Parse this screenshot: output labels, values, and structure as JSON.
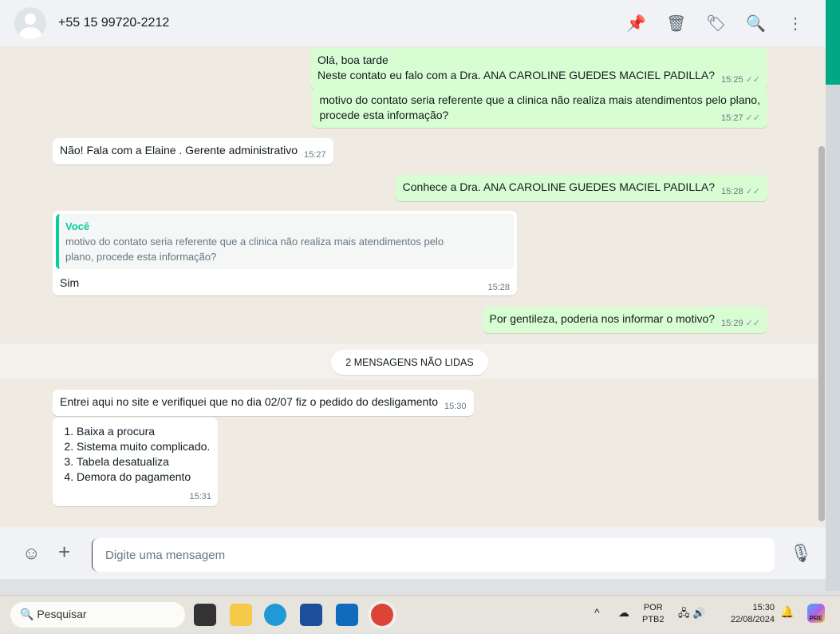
{
  "header": {
    "contact": "+55 15 99720-2212",
    "icons": [
      "pin-icon",
      "delete-icon",
      "label-icon",
      "search-icon",
      "menu-icon"
    ]
  },
  "messages": [
    {
      "dir": "out",
      "lines": [
        "Olá, boa tarde",
        "Neste contato eu falo com a Dra. ANA CAROLINE GUEDES MACIEL PADILLA?"
      ],
      "time": "15:25"
    },
    {
      "dir": "out",
      "lines": [
        "motivo do contato seria referente que a clinica não realiza mais atendimentos pelo plano,",
        "procede esta informação?"
      ],
      "time": "15:27"
    },
    {
      "dir": "in",
      "text": "Não! Fala com a Elaine . Gerente administrativo",
      "time": "15:27"
    },
    {
      "dir": "out",
      "text": "Conhece a Dra. ANA CAROLINE GUEDES MACIEL PADILLA?",
      "time": "15:28"
    },
    {
      "dir": "in",
      "quote_author": "Você",
      "quote_lines": [
        "motivo do contato seria referente que a clinica não realiza mais atendimentos pelo",
        "plano, procede esta informação?"
      ],
      "text": "Sim",
      "time": "15:28"
    },
    {
      "dir": "out",
      "text": "Por gentileza, poderia nos informar o motivo?",
      "time": "15:29"
    },
    {
      "dir": "in",
      "text": "Entrei aqui no site e verifiquei que no dia 02/07 fiz o pedido do desligamento",
      "time": "15:30"
    },
    {
      "dir": "in",
      "list": [
        "Baixa a procura",
        "Sistema muito complicado.",
        "Tabela desatualiza",
        "Demora do pagamento"
      ],
      "time": "15:31"
    }
  ],
  "unread_label": "2 MENSAGENS NÃO LIDAS",
  "composer": {
    "placeholder": "Digite uma mensagem"
  },
  "taskbar": {
    "search": "Pesquisar",
    "lang1": "POR",
    "lang2": "PTB2",
    "time": "15:30",
    "date": "22/08/2024",
    "copilot_badge": "PRE"
  }
}
